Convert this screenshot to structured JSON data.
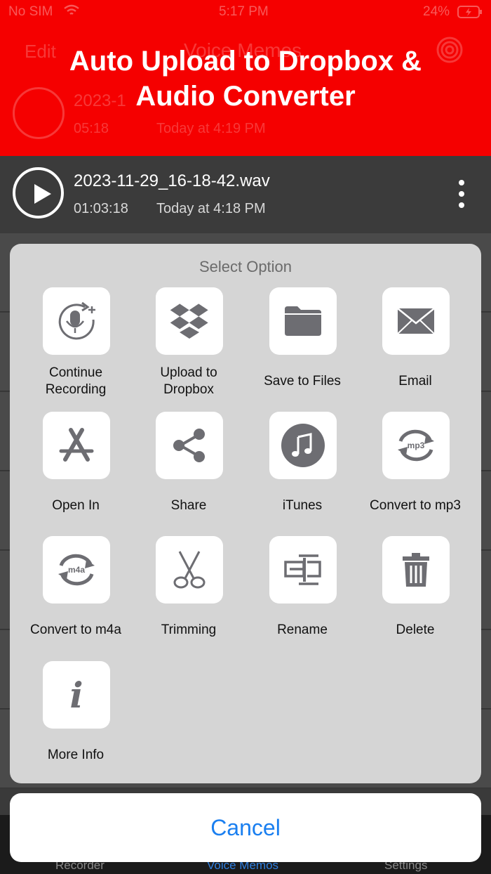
{
  "status_bar": {
    "carrier": "No SIM",
    "time": "5:17 PM",
    "battery": "24%"
  },
  "header": {
    "edit": "Edit",
    "title": "Voice Memos"
  },
  "banner": {
    "title_line1": "Auto Upload to Dropbox &",
    "title_line2": "Audio Converter",
    "color": "#f50000"
  },
  "ghost_recording": {
    "name": "2023-1",
    "duration": "05:18",
    "date": "Today at 4:19 PM"
  },
  "recording": {
    "name": "2023-11-29_16-18-42.wav",
    "duration": "01:03:18",
    "date": "Today at 4:18 PM"
  },
  "sheet": {
    "title": "Select Option",
    "options": [
      {
        "label": "Continue Recording",
        "icon": "mic-continue-icon"
      },
      {
        "label": "Upload to Dropbox",
        "icon": "dropbox-icon"
      },
      {
        "label": "Save to Files",
        "icon": "folder-icon"
      },
      {
        "label": "Email",
        "icon": "envelope-icon"
      },
      {
        "label": "Open In",
        "icon": "app-store-icon"
      },
      {
        "label": "Share",
        "icon": "share-icon"
      },
      {
        "label": "iTunes",
        "icon": "music-note-icon"
      },
      {
        "label": "Convert to mp3",
        "icon": "convert-mp3-icon",
        "badge": "mp3"
      },
      {
        "label": "Convert to m4a",
        "icon": "convert-m4a-icon",
        "badge": "m4a"
      },
      {
        "label": "Trimming",
        "icon": "scissors-icon"
      },
      {
        "label": "Rename",
        "icon": "rename-icon"
      },
      {
        "label": "Delete",
        "icon": "trash-icon"
      },
      {
        "label": "More Info",
        "icon": "info-icon",
        "glyph": "i"
      }
    ],
    "cancel": "Cancel"
  },
  "tabs": [
    {
      "label": "Recorder"
    },
    {
      "label": "Voice Memos",
      "active": true
    },
    {
      "label": "Settings"
    }
  ],
  "colors": {
    "accent": "#1a7ff0",
    "icon_gray": "#6d6d72"
  }
}
